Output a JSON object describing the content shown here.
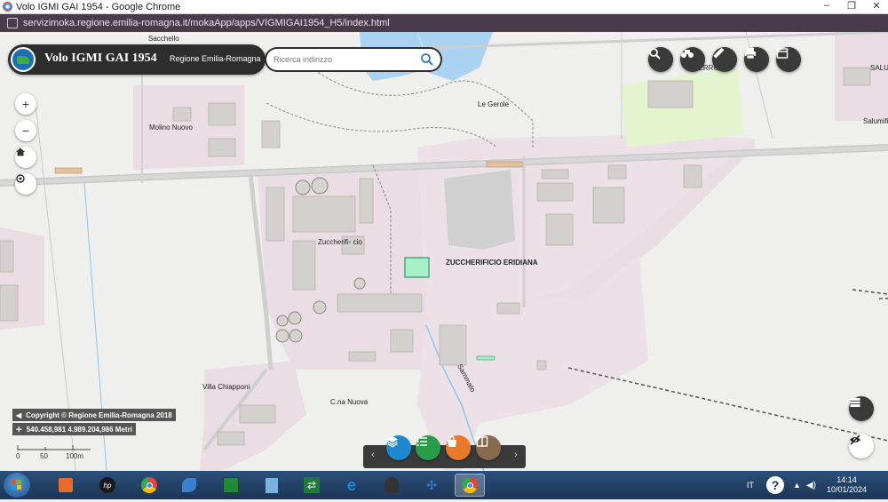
{
  "window": {
    "title": "Volo IGMI GAI 1954 - Google Chrome",
    "url": "servizimoka.regione.emilia-romagna.it/mokaApp/apps/VIGMIGAI1954_H5/index.html",
    "minimize": "–",
    "maximize": "❐",
    "close": "✕"
  },
  "header": {
    "app_title": "Volo IGMI GAI 1954",
    "region": "Regione Emilia-Romagna",
    "logo_icon": "emilia-romagna-logo-icon"
  },
  "search": {
    "placeholder": "Ricerca indirizzo",
    "value": ""
  },
  "toolbar": {
    "buttons": [
      {
        "name": "search",
        "icon": "magnifier-icon"
      },
      {
        "name": "identify",
        "icon": "binoculars-icon"
      },
      {
        "name": "measure",
        "icon": "ruler-icon"
      },
      {
        "name": "print",
        "icon": "printer-icon"
      },
      {
        "name": "window",
        "icon": "window-icon"
      }
    ]
  },
  "zoom": {
    "in": "+",
    "out": "−",
    "home_icon": "home-icon",
    "locate_icon": "target-icon"
  },
  "map_labels": {
    "sacchello": "Sacchello",
    "gerole": "Le Gerole",
    "pierrot": "PIERROT",
    "salu": "SALU",
    "salumi": "Salumifi",
    "molino": "Molino Nuovo",
    "zuccherificio": "Zuccherifi- cio",
    "eridiana": "ZUCCHERIFICIO ERIDIANA",
    "chiapponi": "Villa Chiapponi",
    "canuova": "C.na Nuova",
    "sammato": "Sammato"
  },
  "footer": {
    "copyright": "Copyright © Regione Emilia-Romagna 2018",
    "coordinates": "540.458,981 4.989.204,986 Metri",
    "scale": {
      "zero": "0",
      "mid": "50",
      "end": "100m"
    }
  },
  "bottom_bar": {
    "prev": "‹",
    "next": "›",
    "buttons": [
      {
        "name": "layers",
        "icon": "layers-icon",
        "color": "#1e88d0"
      },
      {
        "name": "legend",
        "icon": "list-icon",
        "color": "#2a9d4a"
      },
      {
        "name": "basemap",
        "icon": "shopping-bag-icon",
        "color": "#e87a2a"
      },
      {
        "name": "compare",
        "icon": "swipe-icon",
        "color": "#8a6a4f"
      }
    ]
  },
  "side_buttons": {
    "table_icon": "table-icon",
    "hide_icon": "eye-off-icon"
  },
  "taskbar": {
    "language": "IT",
    "time": "14:14",
    "date": "10/01/2024",
    "apps": [
      {
        "name": "media-player",
        "icon": "media-player-icon",
        "color": "#e86b2a"
      },
      {
        "name": "hp",
        "icon": "hp-icon",
        "color": "#1a1a1a"
      },
      {
        "name": "chrome",
        "icon": "chrome-icon",
        "color": "#4285f4"
      },
      {
        "name": "feather-app",
        "icon": "feather-icon",
        "color": "#3a7fd0"
      },
      {
        "name": "green-app",
        "icon": "green-app-icon",
        "color": "#1f8a3a"
      },
      {
        "name": "notepad",
        "icon": "notepad-icon",
        "color": "#7ab3e0"
      },
      {
        "name": "arrows-app",
        "icon": "arrows-icon",
        "color": "#1f7a3a"
      },
      {
        "name": "ie",
        "icon": "internet-explorer-icon",
        "color": "#1a88d8"
      },
      {
        "name": "cathedral",
        "icon": "cathedral-icon",
        "color": "#333333"
      },
      {
        "name": "molecule-app",
        "icon": "molecule-icon",
        "color": "#2a8ad0"
      },
      {
        "name": "chrome-active",
        "icon": "chrome-icon",
        "color": "#4285f4"
      }
    ]
  }
}
